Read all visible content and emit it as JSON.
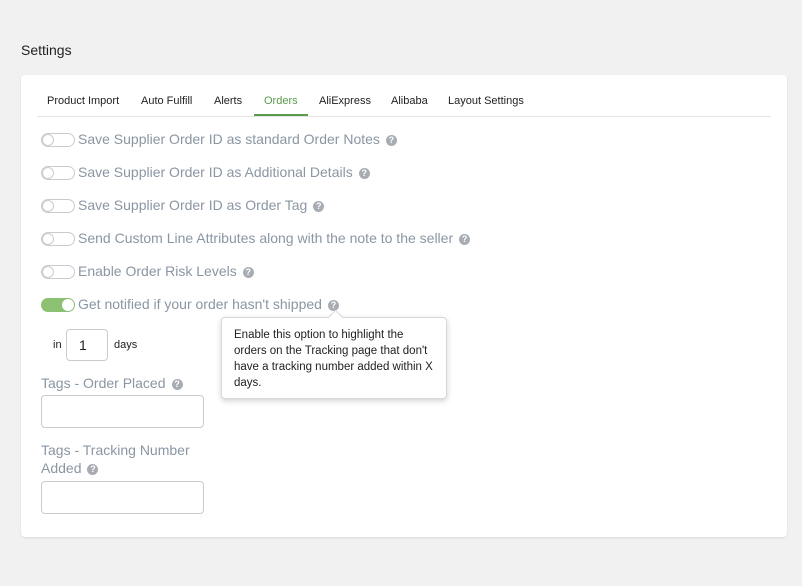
{
  "page": {
    "title": "Settings"
  },
  "tabs": [
    {
      "label": "Product Import"
    },
    {
      "label": "Auto Fulfill"
    },
    {
      "label": "Alerts"
    },
    {
      "label": "Orders"
    },
    {
      "label": "AliExpress"
    },
    {
      "label": "Alibaba"
    },
    {
      "label": "Layout Settings"
    }
  ],
  "active_tab": "Orders",
  "settings": [
    {
      "label": "Save Supplier Order ID as standard Order Notes",
      "enabled": false
    },
    {
      "label": "Save Supplier Order ID as Additional Details",
      "enabled": false
    },
    {
      "label": "Save Supplier Order ID as Order Tag",
      "enabled": false
    },
    {
      "label": "Send Custom Line Attributes along with the note to the seller",
      "enabled": false
    },
    {
      "label": "Enable Order Risk Levels",
      "enabled": false
    },
    {
      "label": "Get notified if your order hasn't shipped",
      "enabled": true
    }
  ],
  "help_glyph": "?",
  "days": {
    "prefix": "in",
    "value": "1",
    "suffix": "days"
  },
  "fields": {
    "order_placed": {
      "label": "Tags - Order Placed",
      "value": ""
    },
    "tracking_added": {
      "label_line1": "Tags - Tracking Number",
      "label_line2": "Added",
      "value": ""
    }
  },
  "tooltip": {
    "text": "Enable this option to highlight the orders on the Tracking page that don't have a tracking number added within X days."
  },
  "colors": {
    "accent": "#5a9a4a",
    "toggle_on": "#8cc072",
    "label": "#8a96a3"
  }
}
